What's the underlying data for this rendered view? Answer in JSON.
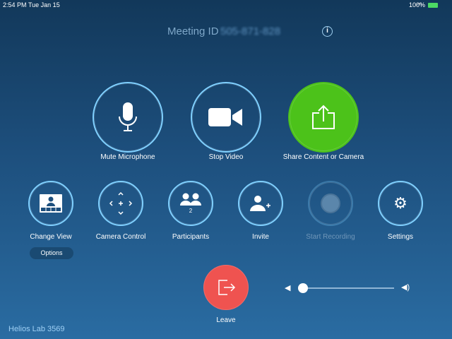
{
  "status_bar": {
    "time": "2:54 PM",
    "date": "Tue Jan 15",
    "battery": "100%"
  },
  "header": {
    "meeting_id_label": "Meeting ID",
    "meeting_id": "505-871-828"
  },
  "main_actions": [
    {
      "label": "Mute Microphone",
      "icon": "microphone-icon"
    },
    {
      "label": "Stop Video",
      "icon": "video-camera-icon"
    },
    {
      "label": "Share Content or Camera",
      "icon": "share-icon"
    }
  ],
  "secondary_actions": [
    {
      "label": "Change View",
      "icon": "layout-icon"
    },
    {
      "label": "Camera Control",
      "icon": "camera-control-icon"
    },
    {
      "label": "Participants",
      "icon": "participants-icon",
      "count": "2"
    },
    {
      "label": "Invite",
      "icon": "invite-icon"
    },
    {
      "label": "Start Recording",
      "icon": "record-icon",
      "disabled": true
    },
    {
      "label": "Settings",
      "icon": "gear-icon"
    }
  ],
  "options_label": "Options",
  "leave_label": "Leave",
  "volume": {
    "level": 0.0
  },
  "room_name": "Helios Lab 3569",
  "colors": {
    "share": "#4cc21a",
    "leave": "#ef5350",
    "ring": "#7fd0ff"
  }
}
